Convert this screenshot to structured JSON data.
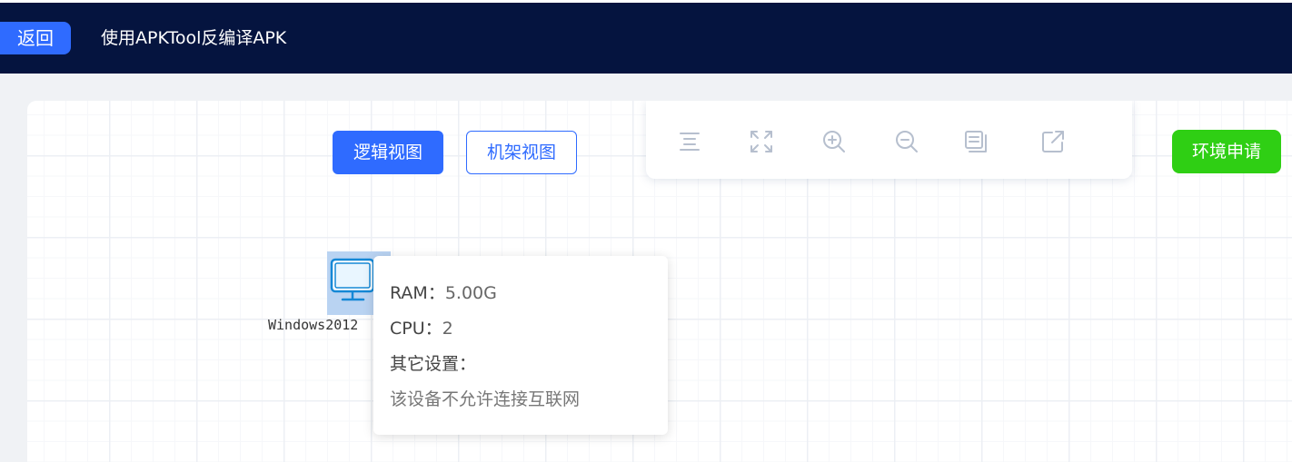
{
  "header": {
    "back_label": "返回",
    "title": "使用APKTool反编译APK"
  },
  "view_switch": {
    "logic_label": "逻辑视图",
    "rack_label": "机架视图",
    "active": "逻辑视图"
  },
  "toolbar": {
    "tools": [
      {
        "icon": "align-center-icon"
      },
      {
        "icon": "fullscreen-icon"
      },
      {
        "icon": "zoom-in-icon"
      },
      {
        "icon": "zoom-out-icon"
      },
      {
        "icon": "minimap-icon"
      },
      {
        "icon": "external-link-icon"
      }
    ]
  },
  "apply_label": "环境申请",
  "node": {
    "label": "Windows2012",
    "icon": "monitor-icon"
  },
  "tooltip": {
    "ram_key": "RAM：",
    "ram_value": "5.00G",
    "cpu_key": "CPU：",
    "cpu_value": "2",
    "other_key": "其它设置：",
    "note": "该设备不允许连接互联网"
  },
  "colors": {
    "header_bg": "#05143f",
    "primary": "#2f6bff",
    "apply_green": "#2fcf14",
    "tool_icon": "#b6bfce"
  }
}
